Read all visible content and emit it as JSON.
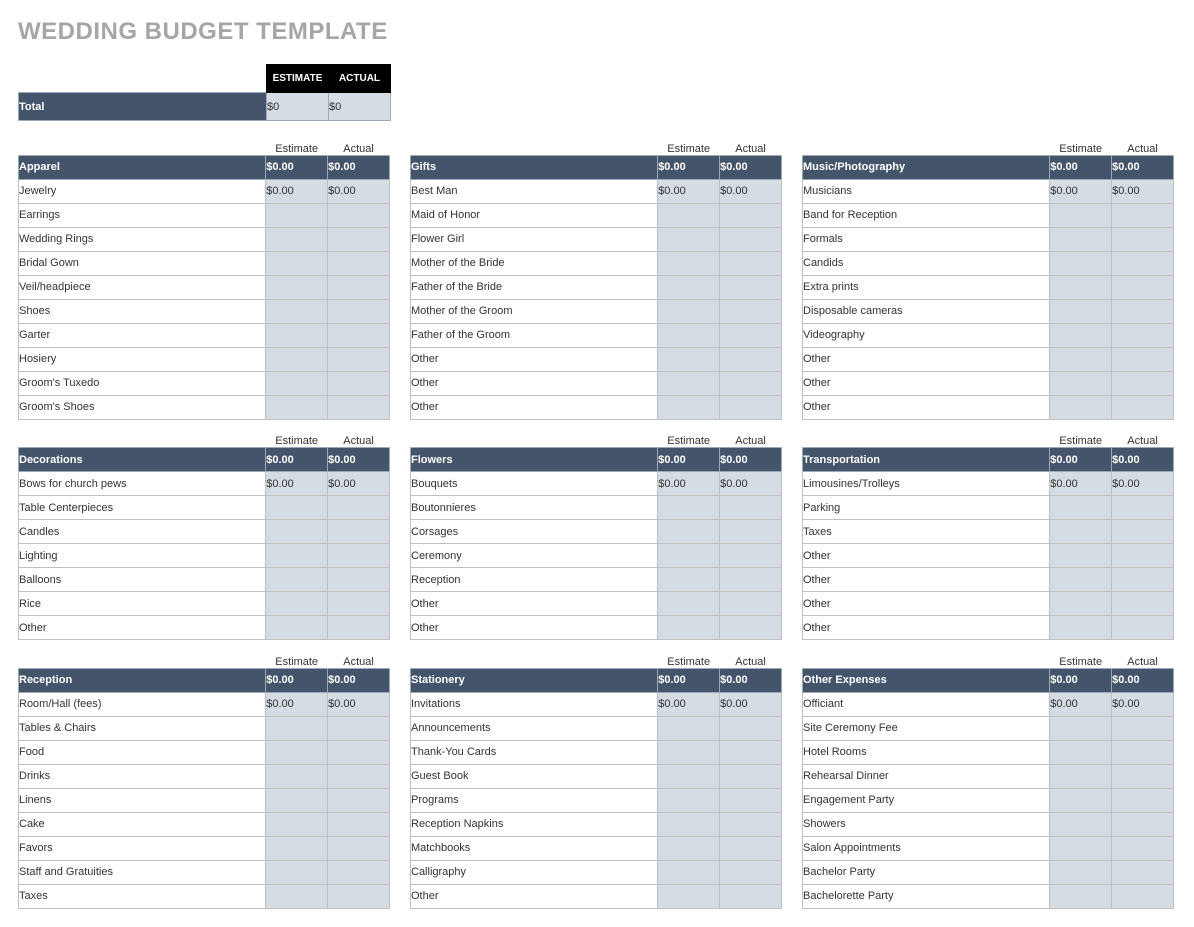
{
  "title": "WEDDING BUDGET TEMPLATE",
  "top": {
    "estimate_header": "ESTIMATE",
    "actual_header": "ACTUAL",
    "total_label": "Total",
    "total_estimate": "$0",
    "total_actual": "$0"
  },
  "col_headers": {
    "estimate": "Estimate",
    "actual": "Actual"
  },
  "rows": [
    [
      {
        "name": "Apparel",
        "estimate": "$0.00",
        "actual": "$0.00",
        "items": [
          {
            "label": "Jewelry",
            "estimate": "$0.00",
            "actual": "$0.00"
          },
          {
            "label": "Earrings",
            "estimate": "",
            "actual": ""
          },
          {
            "label": "Wedding Rings",
            "estimate": "",
            "actual": ""
          },
          {
            "label": "Bridal Gown",
            "estimate": "",
            "actual": ""
          },
          {
            "label": "Veil/headpiece",
            "estimate": "",
            "actual": ""
          },
          {
            "label": "Shoes",
            "estimate": "",
            "actual": ""
          },
          {
            "label": "Garter",
            "estimate": "",
            "actual": ""
          },
          {
            "label": "Hosiery",
            "estimate": "",
            "actual": ""
          },
          {
            "label": "Groom's Tuxedo",
            "estimate": "",
            "actual": ""
          },
          {
            "label": "Groom's Shoes",
            "estimate": "",
            "actual": ""
          }
        ]
      },
      {
        "name": "Gifts",
        "estimate": "$0.00",
        "actual": "$0.00",
        "items": [
          {
            "label": "Best Man",
            "estimate": "$0.00",
            "actual": "$0.00"
          },
          {
            "label": "Maid of Honor",
            "estimate": "",
            "actual": ""
          },
          {
            "label": "Flower Girl",
            "estimate": "",
            "actual": ""
          },
          {
            "label": "Mother of the Bride",
            "estimate": "",
            "actual": ""
          },
          {
            "label": "Father of the Bride",
            "estimate": "",
            "actual": ""
          },
          {
            "label": "Mother of the Groom",
            "estimate": "",
            "actual": ""
          },
          {
            "label": "Father of the Groom",
            "estimate": "",
            "actual": ""
          },
          {
            "label": "Other",
            "estimate": "",
            "actual": ""
          },
          {
            "label": "Other",
            "estimate": "",
            "actual": ""
          },
          {
            "label": "Other",
            "estimate": "",
            "actual": ""
          }
        ]
      },
      {
        "name": "Music/Photography",
        "estimate": "$0.00",
        "actual": "$0.00",
        "items": [
          {
            "label": "Musicians",
            "estimate": "$0.00",
            "actual": "$0.00"
          },
          {
            "label": "Band for Reception",
            "estimate": "",
            "actual": ""
          },
          {
            "label": "Formals",
            "estimate": "",
            "actual": ""
          },
          {
            "label": "Candids",
            "estimate": "",
            "actual": ""
          },
          {
            "label": "Extra prints",
            "estimate": "",
            "actual": ""
          },
          {
            "label": "Disposable cameras",
            "estimate": "",
            "actual": ""
          },
          {
            "label": "Videography",
            "estimate": "",
            "actual": ""
          },
          {
            "label": "Other",
            "estimate": "",
            "actual": ""
          },
          {
            "label": "Other",
            "estimate": "",
            "actual": ""
          },
          {
            "label": "Other",
            "estimate": "",
            "actual": ""
          }
        ]
      }
    ],
    [
      {
        "name": "Decorations",
        "estimate": "$0.00",
        "actual": "$0.00",
        "items": [
          {
            "label": "Bows for church pews",
            "estimate": "$0.00",
            "actual": "$0.00"
          },
          {
            "label": "Table Centerpieces",
            "estimate": "",
            "actual": ""
          },
          {
            "label": "Candles",
            "estimate": "",
            "actual": ""
          },
          {
            "label": "Lighting",
            "estimate": "",
            "actual": ""
          },
          {
            "label": "Balloons",
            "estimate": "",
            "actual": ""
          },
          {
            "label": "Rice",
            "estimate": "",
            "actual": ""
          },
          {
            "label": "Other",
            "estimate": "",
            "actual": ""
          }
        ]
      },
      {
        "name": "Flowers",
        "estimate": "$0.00",
        "actual": "$0.00",
        "items": [
          {
            "label": "Bouquets",
            "estimate": "$0.00",
            "actual": "$0.00"
          },
          {
            "label": "Boutonnieres",
            "estimate": "",
            "actual": ""
          },
          {
            "label": "Corsages",
            "estimate": "",
            "actual": ""
          },
          {
            "label": "Ceremony",
            "estimate": "",
            "actual": ""
          },
          {
            "label": "Reception",
            "estimate": "",
            "actual": ""
          },
          {
            "label": "Other",
            "estimate": "",
            "actual": ""
          },
          {
            "label": "Other",
            "estimate": "",
            "actual": ""
          }
        ]
      },
      {
        "name": "Transportation",
        "estimate": "$0.00",
        "actual": "$0.00",
        "items": [
          {
            "label": "Limousines/Trolleys",
            "estimate": "$0.00",
            "actual": "$0.00"
          },
          {
            "label": "Parking",
            "estimate": "",
            "actual": ""
          },
          {
            "label": "Taxes",
            "estimate": "",
            "actual": ""
          },
          {
            "label": "Other",
            "estimate": "",
            "actual": ""
          },
          {
            "label": "Other",
            "estimate": "",
            "actual": ""
          },
          {
            "label": "Other",
            "estimate": "",
            "actual": ""
          },
          {
            "label": "Other",
            "estimate": "",
            "actual": ""
          }
        ]
      }
    ],
    [
      {
        "name": "Reception",
        "estimate": "$0.00",
        "actual": "$0.00",
        "items": [
          {
            "label": "Room/Hall (fees)",
            "estimate": "$0.00",
            "actual": "$0.00"
          },
          {
            "label": "Tables & Chairs",
            "estimate": "",
            "actual": ""
          },
          {
            "label": "Food",
            "estimate": "",
            "actual": ""
          },
          {
            "label": "Drinks",
            "estimate": "",
            "actual": ""
          },
          {
            "label": "Linens",
            "estimate": "",
            "actual": ""
          },
          {
            "label": "Cake",
            "estimate": "",
            "actual": ""
          },
          {
            "label": "Favors",
            "estimate": "",
            "actual": ""
          },
          {
            "label": "Staff and Gratuities",
            "estimate": "",
            "actual": ""
          },
          {
            "label": "Taxes",
            "estimate": "",
            "actual": ""
          }
        ]
      },
      {
        "name": "Stationery",
        "estimate": "$0.00",
        "actual": "$0.00",
        "items": [
          {
            "label": "Invitations",
            "estimate": "$0.00",
            "actual": "$0.00"
          },
          {
            "label": "Announcements",
            "estimate": "",
            "actual": ""
          },
          {
            "label": "Thank-You Cards",
            "estimate": "",
            "actual": ""
          },
          {
            "label": "Guest Book",
            "estimate": "",
            "actual": ""
          },
          {
            "label": "Programs",
            "estimate": "",
            "actual": ""
          },
          {
            "label": "Reception Napkins",
            "estimate": "",
            "actual": ""
          },
          {
            "label": "Matchbooks",
            "estimate": "",
            "actual": ""
          },
          {
            "label": "Calligraphy",
            "estimate": "",
            "actual": ""
          },
          {
            "label": "Other",
            "estimate": "",
            "actual": ""
          }
        ]
      },
      {
        "name": "Other Expenses",
        "estimate": "$0.00",
        "actual": "$0.00",
        "items": [
          {
            "label": "Officiant",
            "estimate": "$0.00",
            "actual": "$0.00"
          },
          {
            "label": "Site Ceremony Fee",
            "estimate": "",
            "actual": ""
          },
          {
            "label": "Hotel Rooms",
            "estimate": "",
            "actual": ""
          },
          {
            "label": "Rehearsal Dinner",
            "estimate": "",
            "actual": ""
          },
          {
            "label": "Engagement Party",
            "estimate": "",
            "actual": ""
          },
          {
            "label": "Showers",
            "estimate": "",
            "actual": ""
          },
          {
            "label": "Salon Appointments",
            "estimate": "",
            "actual": ""
          },
          {
            "label": "Bachelor Party",
            "estimate": "",
            "actual": ""
          },
          {
            "label": "Bachelorette Party",
            "estimate": "",
            "actual": ""
          }
        ]
      }
    ]
  ]
}
